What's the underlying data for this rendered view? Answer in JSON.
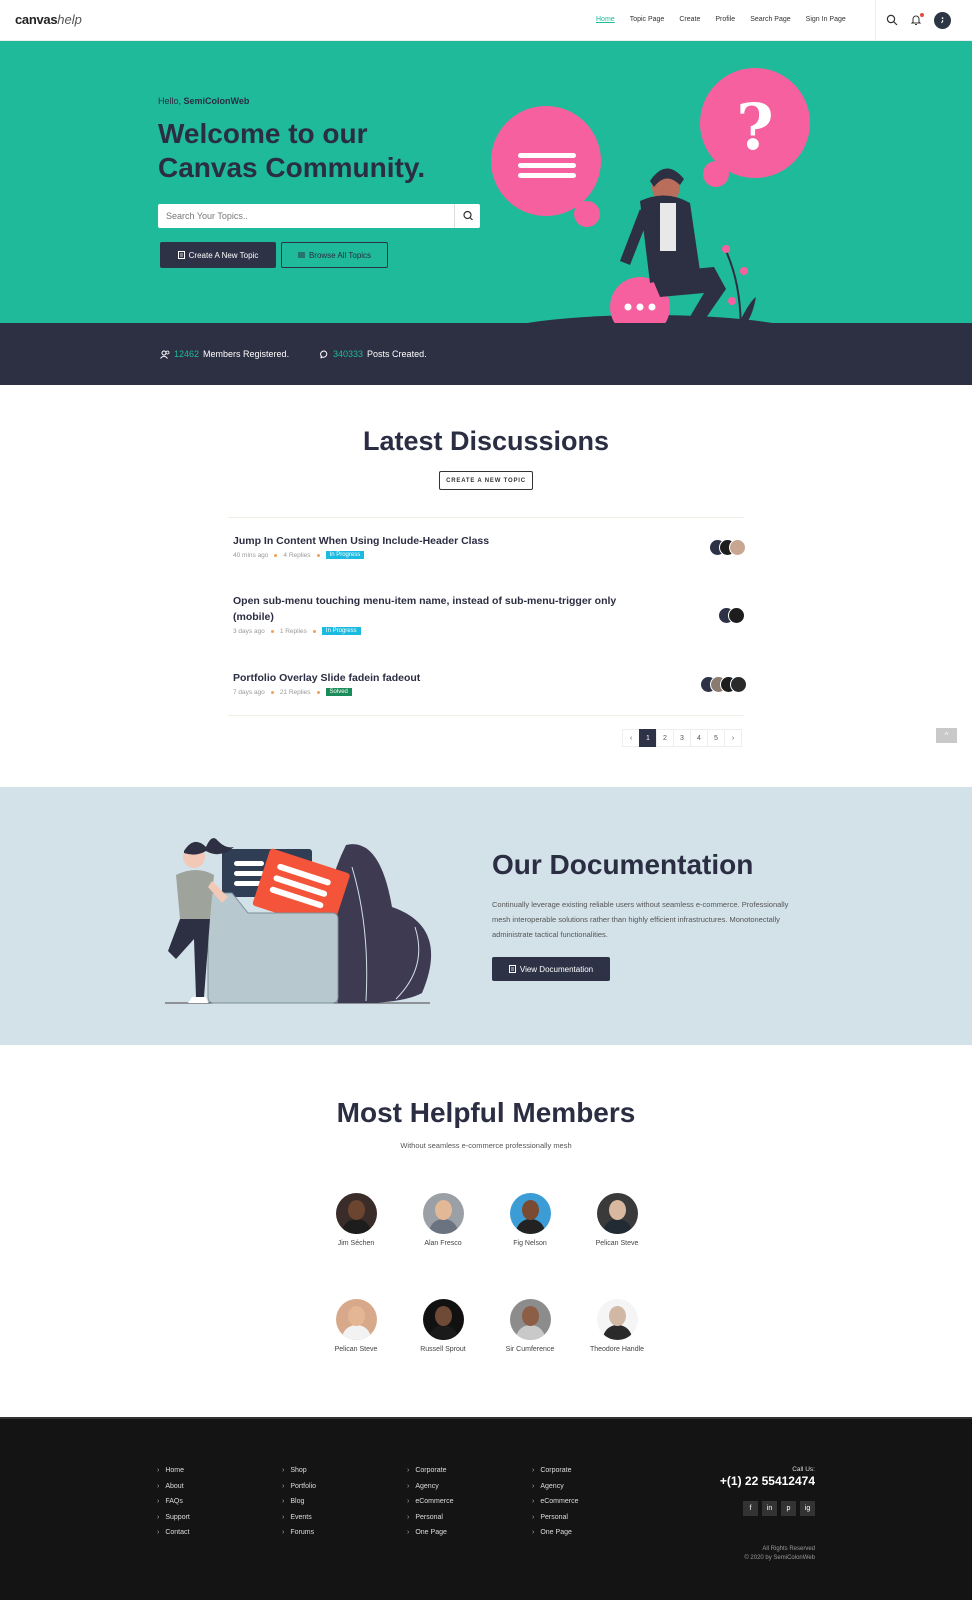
{
  "header": {
    "logo_main": "canvas",
    "logo_sub": "help",
    "nav": [
      "Home",
      "Topic Page",
      "Create",
      "Profile",
      "Search Page",
      "Sign In Page"
    ],
    "active_nav": "Home"
  },
  "hero": {
    "hello_prefix": "Hello,",
    "hello_name": "SemiColonWeb",
    "title_line1": "Welcome to our",
    "title_line2": "Canvas Community.",
    "search_placeholder": "Search Your Topics..",
    "create_btn": "Create A New Topic",
    "browse_btn": "Browse All Topics",
    "colors": {
      "bg": "#1fba99",
      "bubble": "#f7609e",
      "dark": "#2d3246"
    }
  },
  "stats": {
    "members_num": "12462",
    "members_label": "Members Registered.",
    "posts_num": "340333",
    "posts_label": "Posts Created."
  },
  "discussions": {
    "title": "Latest Discussions",
    "create_btn": "CREATE A NEW TOPIC",
    "topics": [
      {
        "title": "Jump In Content When Using Include-Header Class",
        "time": "40 mins ago",
        "replies": "4 Replies",
        "status": "In Progress",
        "status_color": "#1bbae1"
      },
      {
        "title": "Open sub-menu touching menu-item name, instead of sub-menu-trigger only (mobile)",
        "time": "3 days ago",
        "replies": "1 Replies",
        "status": "In Progress",
        "status_color": "#1bbae1"
      },
      {
        "title": "Portfolio Overlay Slide fadein fadeout",
        "time": "7 days ago",
        "replies": "21 Replies",
        "status": "Solved",
        "status_color": "#1a8c5a"
      }
    ],
    "pagination": [
      "‹",
      "1",
      "2",
      "3",
      "4",
      "5",
      "›"
    ],
    "active_page": "1",
    "to_top": "^"
  },
  "documentation": {
    "title": "Our Documentation",
    "text": "Continually leverage existing reliable users without seamless e-commerce. Professionally mesh interoperable solutions rather than highly efficient infrastructures. Monotonectally administrate tactical functionalities.",
    "button": "View Documentation"
  },
  "members": {
    "title": "Most Helpful Members",
    "subtitle": "Without seamless e-commerce professionally mesh",
    "list": [
      {
        "name": "Jim Séchen",
        "bg": "#3a2c28",
        "skin": "#6b4530",
        "shirt": "#1d1d1d"
      },
      {
        "name": "Alan Fresco",
        "bg": "#9aa0a6",
        "skin": "#e2b896",
        "shirt": "#6b7280"
      },
      {
        "name": "Fig Nelson",
        "bg": "#3b9cd6",
        "skin": "#7a4a32",
        "shirt": "#222222"
      },
      {
        "name": "Pelican Steve",
        "bg": "#3a3a3a",
        "skin": "#d8b89e",
        "shirt": "#222a33"
      },
      {
        "name": "Pelican Steve",
        "bg": "#d7a98a",
        "skin": "#e4b693",
        "shirt": "#f2f2f2"
      },
      {
        "name": "Russell Sprout",
        "bg": "#111111",
        "skin": "#6f4a36",
        "shirt": "#1a1a1a"
      },
      {
        "name": "Sir Cumference",
        "bg": "#8c8c8c",
        "skin": "#8b5e45",
        "shirt": "#c9c9c9"
      },
      {
        "name": "Theodore Handle",
        "bg": "#f5f5f5",
        "skin": "#d0b8a4",
        "shirt": "#2a2a2a"
      }
    ]
  },
  "footer": {
    "col1": [
      "Home",
      "About",
      "FAQs",
      "Support",
      "Contact"
    ],
    "col2": [
      "Shop",
      "Portfolio",
      "Blog",
      "Events",
      "Forums"
    ],
    "col3": [
      "Corporate",
      "Agency",
      "eCommerce",
      "Personal",
      "One Page"
    ],
    "col4": [
      "Corporate",
      "Agency",
      "eCommerce",
      "Personal",
      "One Page"
    ],
    "call_label": "Call Us:",
    "phone": "+(1) 22 55412474",
    "socials": [
      "f",
      "in",
      "p",
      "ig"
    ],
    "rights": "All Rights Reserved",
    "copyright": "© 2020 by SemiColonWeb"
  }
}
